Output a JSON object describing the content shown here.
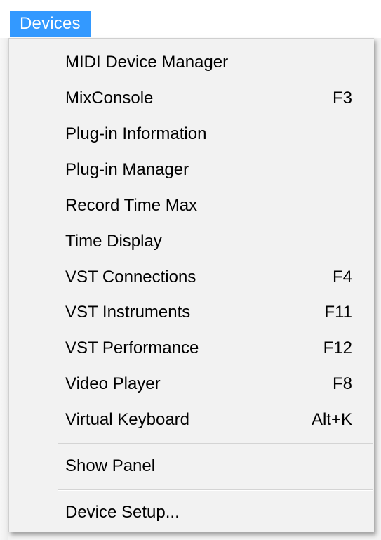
{
  "menubar": {
    "active_menu": "Devices"
  },
  "menu": {
    "items": [
      {
        "label": "MIDI Device Manager",
        "shortcut": ""
      },
      {
        "label": "MixConsole",
        "shortcut": "F3"
      },
      {
        "label": "Plug-in Information",
        "shortcut": ""
      },
      {
        "label": "Plug-in Manager",
        "shortcut": ""
      },
      {
        "label": "Record Time Max",
        "shortcut": ""
      },
      {
        "label": "Time Display",
        "shortcut": ""
      },
      {
        "label": "VST Connections",
        "shortcut": "F4"
      },
      {
        "label": "VST Instruments",
        "shortcut": "F11"
      },
      {
        "label": "VST Performance",
        "shortcut": "F12"
      },
      {
        "label": "Video Player",
        "shortcut": "F8"
      },
      {
        "label": "Virtual Keyboard",
        "shortcut": "Alt+K"
      }
    ],
    "panel_item": {
      "label": "Show Panel"
    },
    "setup_item": {
      "label": "Device Setup..."
    }
  },
  "colors": {
    "highlight": "#3399ff",
    "menu_background": "#f2f2f2",
    "text": "#000000"
  }
}
